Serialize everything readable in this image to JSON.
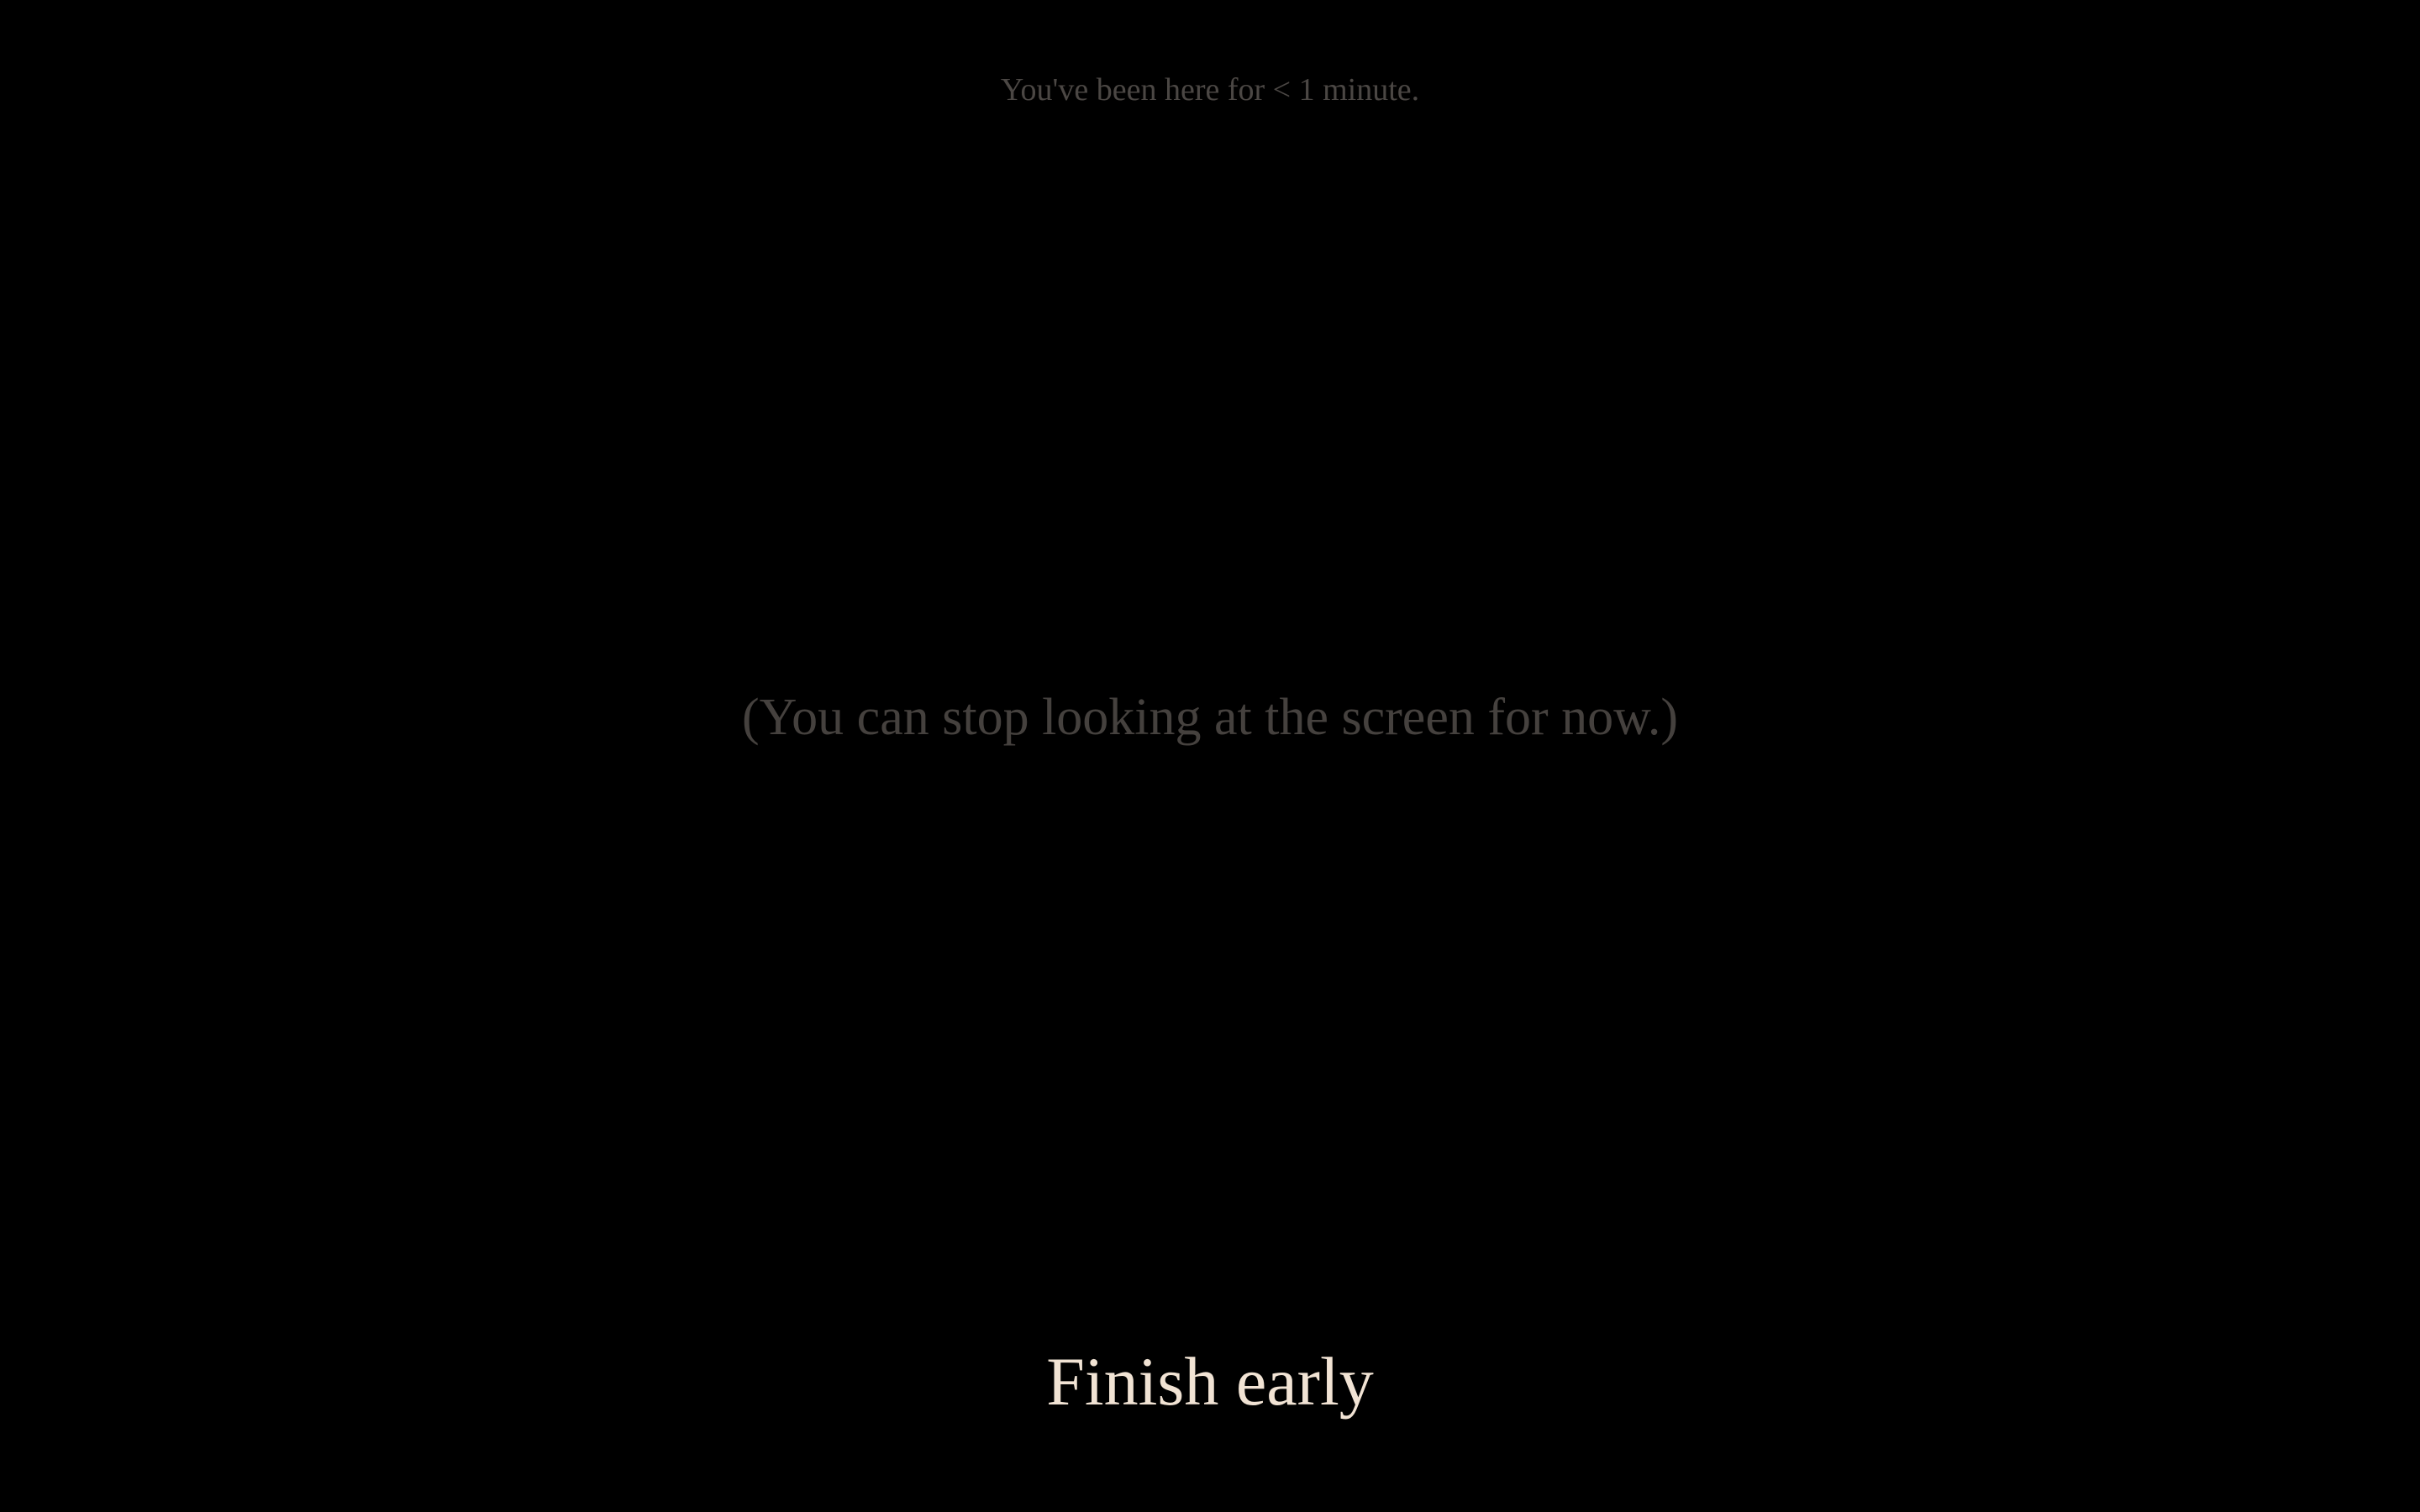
{
  "session": {
    "elapsed_text": "You've been here for < 1 minute."
  },
  "main": {
    "message": "(You can stop looking at the screen for now.)"
  },
  "actions": {
    "finish_label": "Finish early"
  },
  "colors": {
    "background": "#000000",
    "muted_text": "#4b4744",
    "accent_text": "#f1e3d4"
  }
}
